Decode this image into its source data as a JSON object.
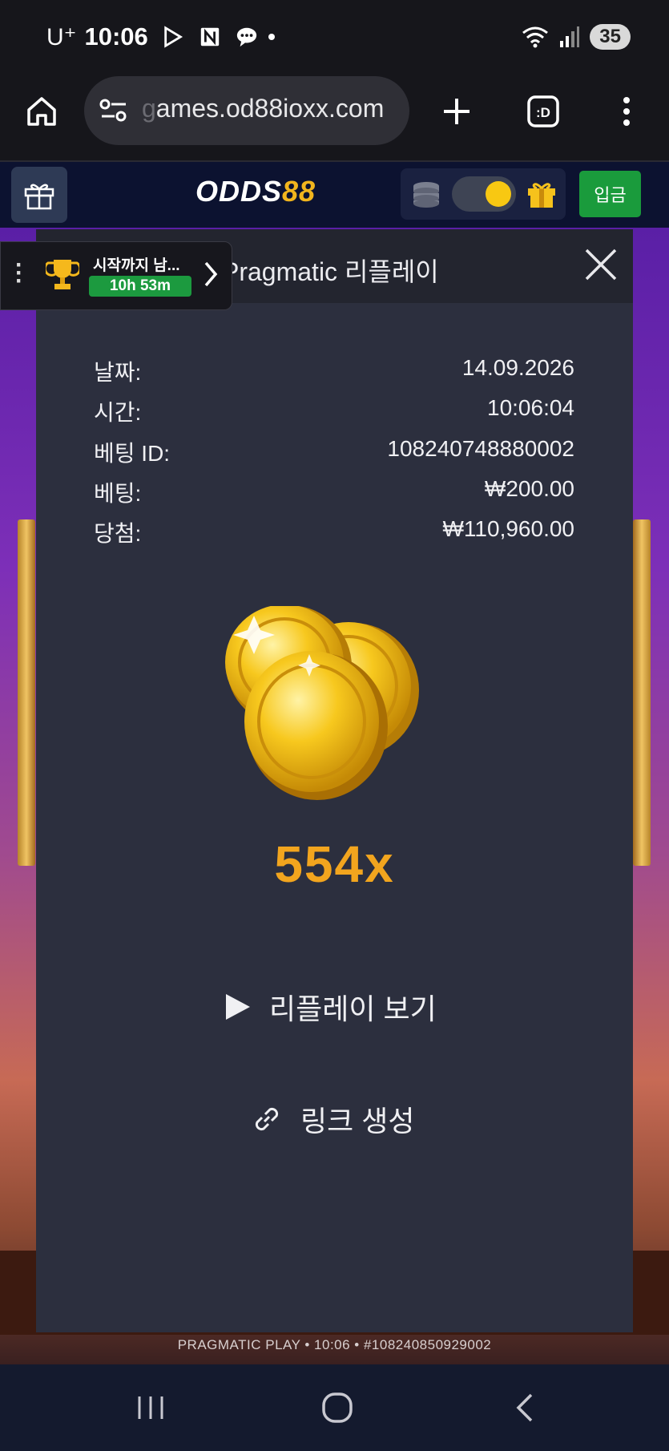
{
  "status_bar": {
    "carrier": "U⁺",
    "time": "10:06",
    "battery": "35",
    "icons": [
      "play-store-icon",
      "n-icon",
      "chat-icon",
      "dot-icon",
      "wifi-icon",
      "signal-icon"
    ]
  },
  "browser": {
    "url_faded": "g",
    "url": "ames.od88ioxx.com",
    "icons": [
      "home-icon",
      "site-settings-icon",
      "new-tab-icon",
      "tab-switcher-icon",
      "more-icon"
    ],
    "tab_switcher_label": ":D"
  },
  "site_header": {
    "logo_main": "ODDS",
    "logo_accent": "88",
    "deposit_label": "입금",
    "accent_color": "#f2b51d",
    "deposit_color": "#1a9b3c"
  },
  "tournament": {
    "title": "시작까지 남...",
    "timer": "10h 53m"
  },
  "modal": {
    "title": "Pragmatic 리플레이",
    "rows": [
      {
        "label": "날짜:",
        "value": "14.09.2026"
      },
      {
        "label": "시간:",
        "value": "10:06:04"
      },
      {
        "label": "베팅 ID:",
        "value": "108240748880002"
      },
      {
        "label": "베팅:",
        "value": "₩200.00"
      },
      {
        "label": "당첨:",
        "value": "₩110,960.00"
      }
    ],
    "multiplier": "554x",
    "replay_label": "리플레이 보기",
    "link_label": "링크 생성"
  },
  "game_footer": "PRAGMATIC PLAY • 10:06 • #108240850929002"
}
